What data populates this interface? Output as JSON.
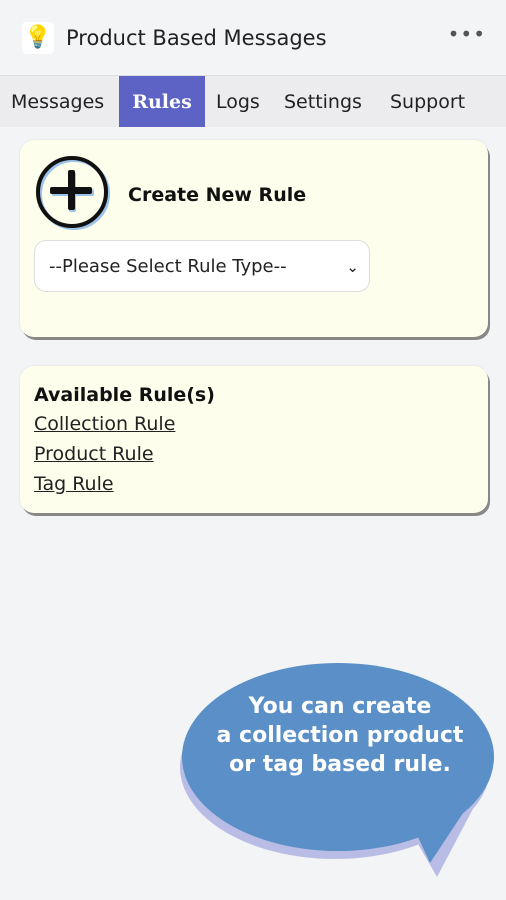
{
  "header": {
    "title": "Product Based Messages",
    "logo_icon": "lightbulb-icon",
    "more_icon": "more-horizontal-icon"
  },
  "tabs": [
    {
      "label": "Messages"
    },
    {
      "label": "Rules",
      "active": true
    },
    {
      "label": "Logs"
    },
    {
      "label": "Settings"
    },
    {
      "label": "Support"
    }
  ],
  "create": {
    "title": "Create New Rule",
    "icon": "plus-circle-icon",
    "select_value": "--Please Select Rule Type--"
  },
  "available": {
    "title": "Available Rule(s)",
    "links": [
      "Collection Rule",
      "Product Rule",
      "Tag Rule"
    ]
  },
  "callout": {
    "lines": [
      "You can create",
      "a collection product",
      "or tag based rule."
    ]
  },
  "colors": {
    "accent": "#5c63c4",
    "card": "#fefeed",
    "bubble": "#5b8fc7",
    "bubble_shadow": "#b9bde6"
  }
}
